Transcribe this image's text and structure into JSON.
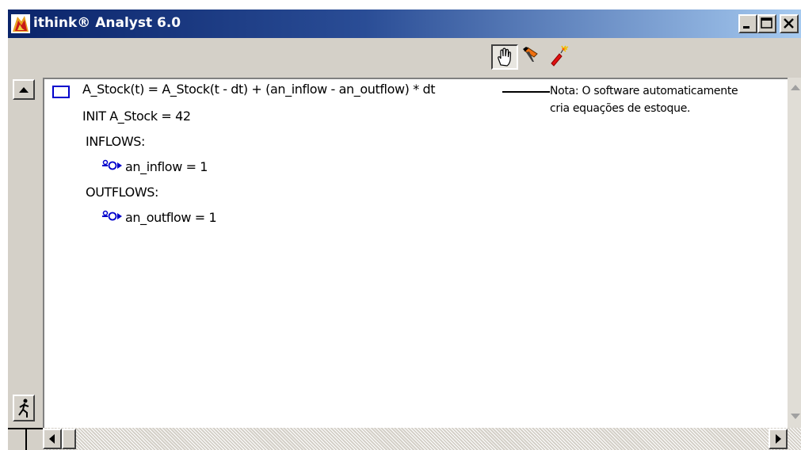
{
  "window": {
    "title": "ithink® Analyst 6.0",
    "titlebar_buttons": [
      "minimize",
      "maximize",
      "close"
    ]
  },
  "toolbar": {
    "tools": [
      {
        "icon": "hand-icon",
        "selected": true
      },
      {
        "icon": "paintbrush-icon",
        "selected": false
      },
      {
        "icon": "dynamite-icon",
        "selected": false
      }
    ]
  },
  "equations": {
    "stock_equation": "A_Stock(t) = A_Stock(t - dt) + (an_inflow - an_outflow) * dt",
    "init": "INIT A_Stock = 42",
    "inflows_header": "INFLOWS:",
    "inflow": "an_inflow = 1",
    "outflows_header": "OUTFLOWS:",
    "outflow": "an_outflow = 1"
  },
  "annotation": {
    "line1": "Nota: O software automaticamente",
    "line2": "cria equações de estoque."
  },
  "colors": {
    "titlebar_start": "#0a246a",
    "titlebar_end": "#a6caf0",
    "icon_blue": "#0000cc"
  }
}
